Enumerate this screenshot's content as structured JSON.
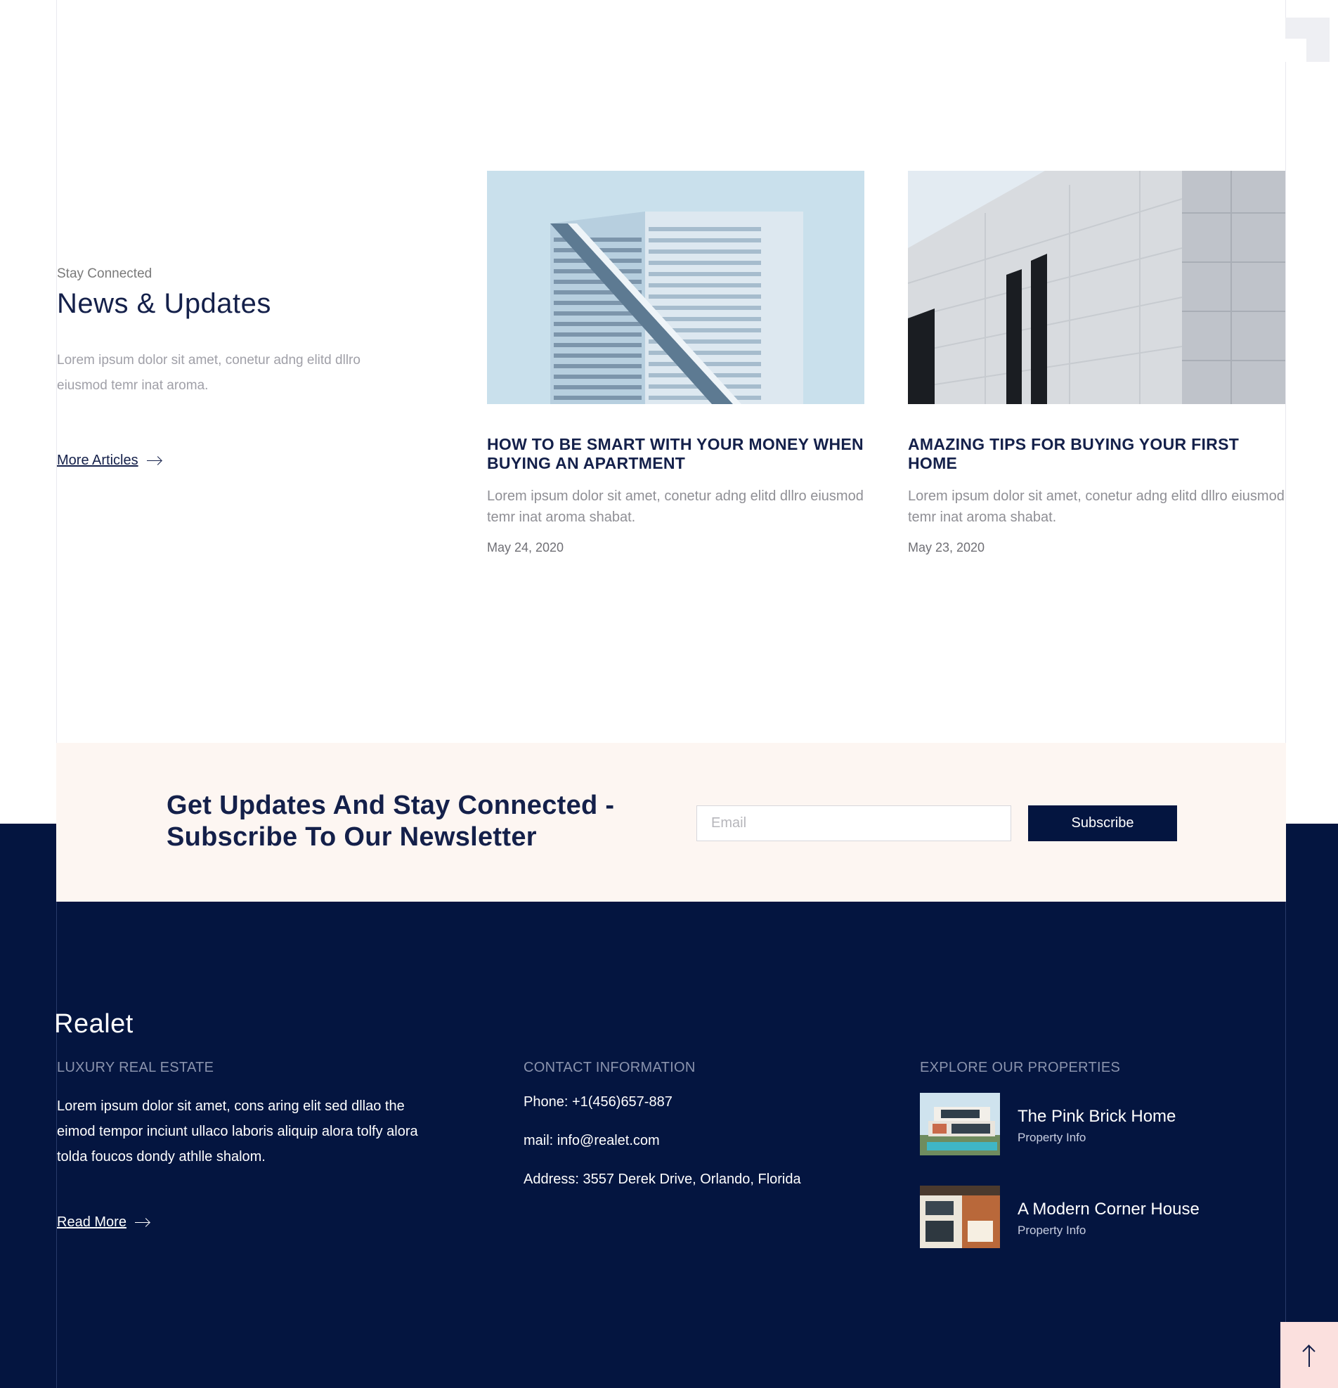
{
  "colors": {
    "navy": "#041540",
    "heading": "#14204a",
    "newsletter_bg": "#fdf6f2",
    "scroll_top_bg": "#fbe0de"
  },
  "news": {
    "eyebrow": "Stay Connected",
    "title": "News & Updates",
    "description": "Lorem ipsum dolor sit amet, conetur adng elitd dllro eiusmod temr inat aroma.",
    "more_label": "More Articles",
    "articles": [
      {
        "title": "HOW TO BE SMART WITH YOUR MONEY WHEN BUYING AN APARTMENT",
        "excerpt": "Lorem ipsum dolor sit amet, conetur adng elitd dllro eiusmod temr inat aroma shabat.",
        "date": "May 24, 2020",
        "image": "glass-skyscraper-photo"
      },
      {
        "title": "AMAZING TIPS FOR BUYING YOUR FIRST HOME",
        "excerpt": "Lorem ipsum dolor sit amet, conetur adng elitd dllro eiusmod temr inat aroma shabat.",
        "date": "May 23, 2020",
        "image": "stone-building-photo"
      }
    ]
  },
  "newsletter": {
    "title": "Get Updates And Stay Connected - Subscribe To Our Newsletter",
    "email_placeholder": "Email",
    "subscribe_label": "Subscribe"
  },
  "footer": {
    "brand": "Realet",
    "about": {
      "heading": "LUXURY REAL ESTATE",
      "text": "Lorem ipsum dolor sit amet, cons aring elit sed dllao the eimod tempor inciunt ullaco laboris aliquip alora tolfy alora tolda foucos dondy athlle shalom.",
      "read_more_label": "Read More"
    },
    "contact": {
      "heading": "CONTACT INFORMATION",
      "phone": "Phone: +1(456)657-887",
      "mail": "mail: info@realet.com",
      "address": "Address: 3557 Derek Drive, Orlando, Florida"
    },
    "properties": {
      "heading": "EXPLORE OUR PROPERTIES",
      "items": [
        {
          "name": "The Pink Brick Home",
          "sub": "Property Info",
          "image": "modern-villa-pool-photo"
        },
        {
          "name": "A Modern Corner House",
          "sub": "Property Info",
          "image": "wood-corner-house-photo"
        }
      ]
    }
  },
  "scroll_top_icon": "arrow-up-icon"
}
